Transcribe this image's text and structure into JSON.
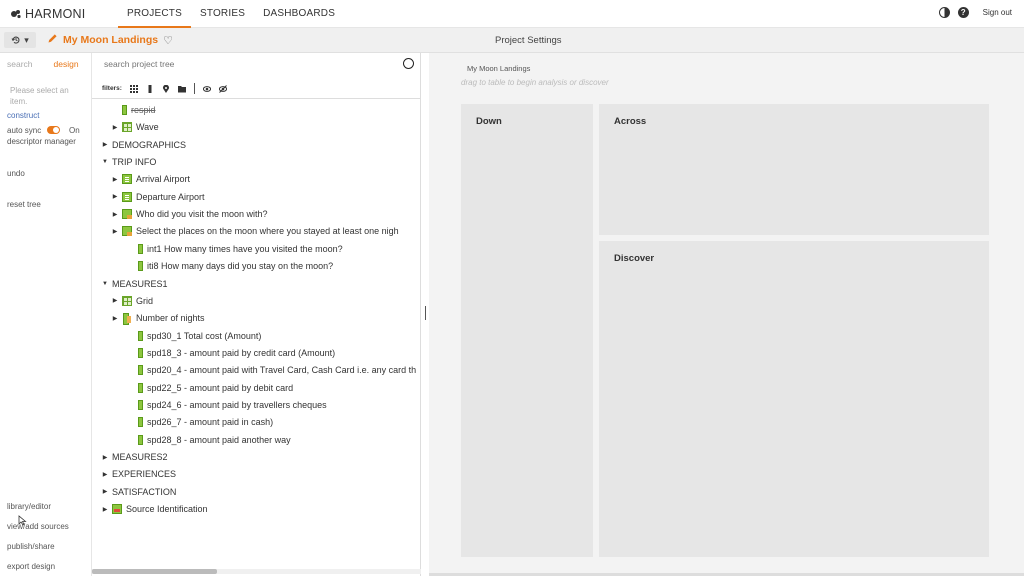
{
  "app": {
    "logo_text": "HARMONI",
    "nav_tabs": [
      "PROJECTS",
      "STORIES",
      "DASHBOARDS"
    ],
    "active_tab": "PROJECTS",
    "help_glyph": "?",
    "signout_label": "Sign out",
    "accent_color": "#e8781a"
  },
  "subbar": {
    "history_caret": "▾",
    "project_name": "My Moon Landings",
    "heart_glyph": "♡",
    "settings_label": "Project Settings"
  },
  "left_panel": {
    "tab_search": "search",
    "tab_design": "design",
    "prompt": "Please select an item.",
    "construct": "construct",
    "auto_sync": "auto sync",
    "auto_sync_state": "On",
    "descriptor_manager": "descriptor manager",
    "undo": "undo",
    "reset_tree": "reset tree",
    "bottom_links": [
      "library/editor",
      "view/add sources",
      "publish/share",
      "export design"
    ]
  },
  "tree_panel": {
    "search_placeholder": "search project tree",
    "filters_label": "filters:",
    "rows": [
      {
        "label": "respid",
        "icon": "bar",
        "depth": 1,
        "arrow": "",
        "strike": true
      },
      {
        "label": "Wave",
        "icon": "table",
        "depth": 1,
        "arrow": "▶"
      },
      {
        "label": "DEMOGRAPHICS",
        "icon": "",
        "depth": 0,
        "arrow": "▶"
      },
      {
        "label": "TRIP INFO",
        "icon": "",
        "depth": 0,
        "arrow": "▼"
      },
      {
        "label": "Arrival Airport",
        "icon": "doc",
        "depth": 1,
        "arrow": "▶"
      },
      {
        "label": "Departure Airport",
        "icon": "doc",
        "depth": 1,
        "arrow": "▶"
      },
      {
        "label": "Who did you visit the moon with?",
        "icon": "multi",
        "depth": 1,
        "arrow": "▶"
      },
      {
        "label": "Select the places on the moon where you stayed at least one nigh",
        "icon": "multi",
        "depth": 1,
        "arrow": "▶"
      },
      {
        "label": "int1 How many times have you visited the moon?",
        "icon": "bar",
        "depth": 2,
        "arrow": ""
      },
      {
        "label": "iti8 How many days did you stay on the moon?",
        "icon": "bar",
        "depth": 2,
        "arrow": ""
      },
      {
        "label": "MEASURES1",
        "icon": "",
        "depth": 0,
        "arrow": "▼"
      },
      {
        "label": "Grid",
        "icon": "table",
        "depth": 1,
        "arrow": "▶"
      },
      {
        "label": "Number of nights",
        "icon": "num",
        "depth": 1,
        "arrow": "▶"
      },
      {
        "label": "spd30_1 Total cost (Amount)",
        "icon": "bar",
        "depth": 2,
        "arrow": ""
      },
      {
        "label": "spd18_3 - amount paid by credit card (Amount)",
        "icon": "bar",
        "depth": 2,
        "arrow": ""
      },
      {
        "label": "spd20_4 - amount paid with Travel Card, Cash Card i.e. any card th",
        "icon": "bar",
        "depth": 2,
        "arrow": ""
      },
      {
        "label": "spd22_5 - amount paid by debit card",
        "icon": "bar",
        "depth": 2,
        "arrow": ""
      },
      {
        "label": "spd24_6 - amount paid by travellers cheques",
        "icon": "bar",
        "depth": 2,
        "arrow": ""
      },
      {
        "label": "spd26_7 - amount paid in cash)",
        "icon": "bar",
        "depth": 2,
        "arrow": ""
      },
      {
        "label": "spd28_8 - amount paid another way",
        "icon": "bar",
        "depth": 2,
        "arrow": ""
      },
      {
        "label": "MEASURES2",
        "icon": "",
        "depth": 0,
        "arrow": "▶"
      },
      {
        "label": "EXPERIENCES",
        "icon": "",
        "depth": 0,
        "arrow": "▶"
      },
      {
        "label": "SATISFACTION",
        "icon": "",
        "depth": 0,
        "arrow": "▶"
      },
      {
        "label": "Source Identification",
        "icon": "source",
        "depth": 0,
        "arrow": "▶"
      }
    ]
  },
  "canvas": {
    "title": "My Moon Landings",
    "hint": "drag to table to begin analysis or discover",
    "zone_down": "Down",
    "zone_across": "Across",
    "zone_discover": "Discover"
  }
}
